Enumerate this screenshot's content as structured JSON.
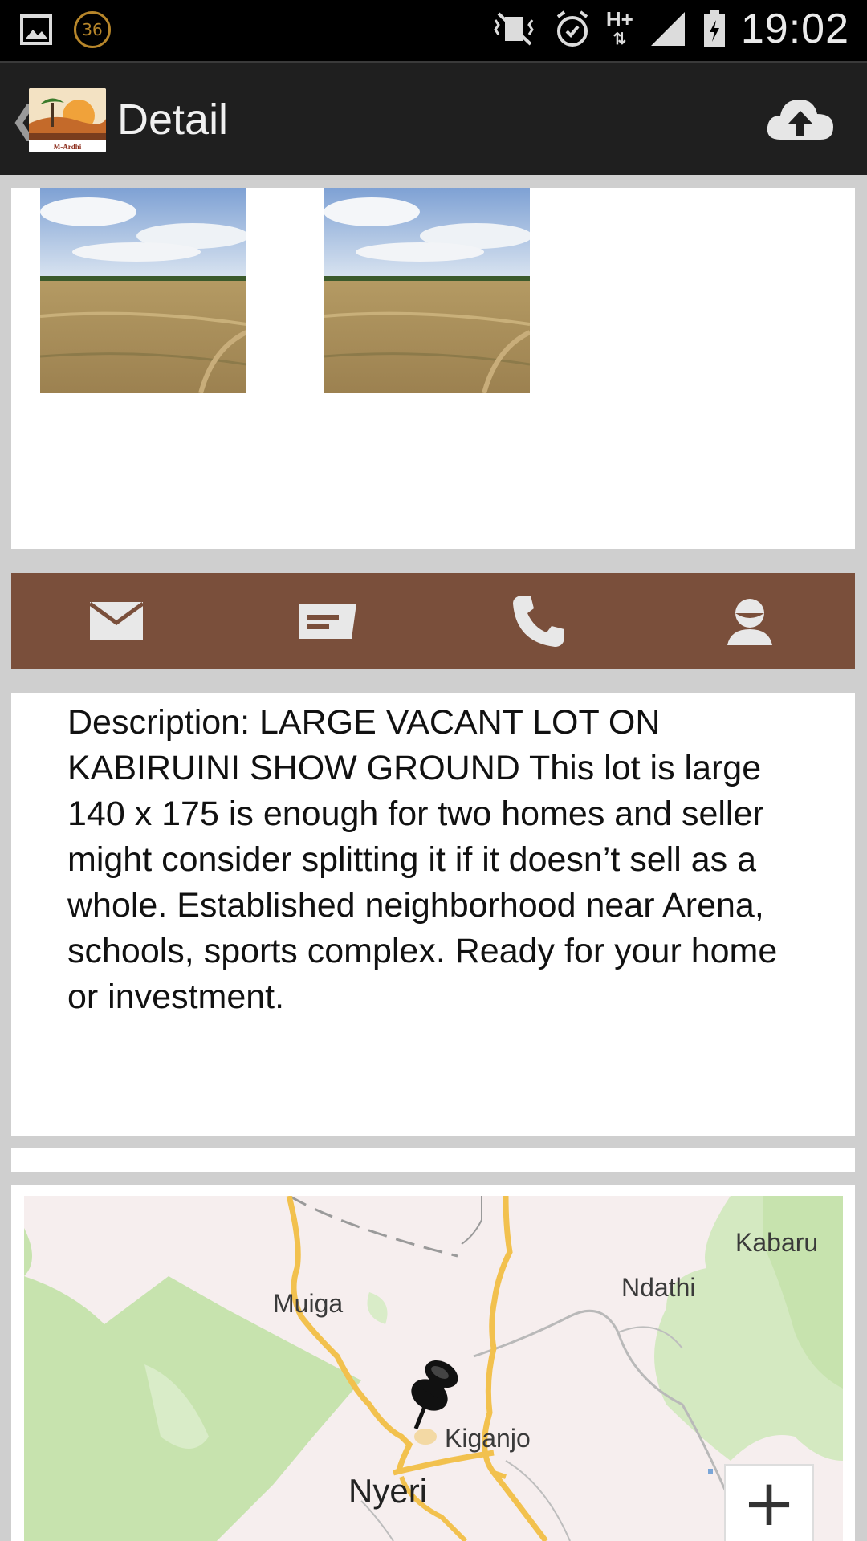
{
  "status_bar": {
    "notification_count": "36",
    "time": "19:02",
    "network": "H+"
  },
  "action_bar": {
    "title": "Detail",
    "logo_text": "M-Ardhi"
  },
  "contact_actions": [
    {
      "icon": "email-icon"
    },
    {
      "icon": "message-icon"
    },
    {
      "icon": "phone-icon"
    },
    {
      "icon": "profile-icon"
    }
  ],
  "description": {
    "text": "Description: LARGE VACANT LOT ON KABIRUINI SHOW GROUND  This lot is large 140 x 175 is enough for two homes and seller might consider splitting it if it doesn’t sell as a whole.  Established neighborhood near Arena, schools, sports complex. Ready for your home or investment."
  },
  "map": {
    "labels": {
      "kabaru": "Kabaru",
      "ndathi": "Ndathi",
      "muiga": "Muiga",
      "kiganjo": "Kiganjo",
      "nyeri": "Nyeri"
    },
    "zoom_in_label": "+"
  },
  "colors": {
    "contact_bar": "#7a4f3b",
    "action_bar": "#1f1f1f",
    "map_green": "#c7e3ae",
    "map_road": "#f2c14e"
  }
}
